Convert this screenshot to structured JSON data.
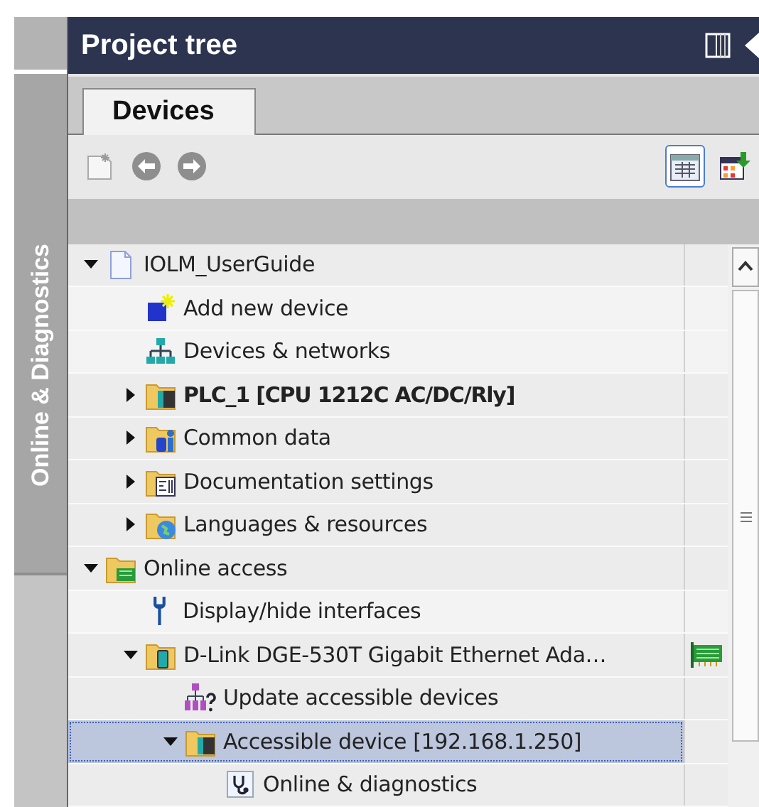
{
  "side_tab": {
    "label": "Online & Diagnostics"
  },
  "panel": {
    "title": "Project tree"
  },
  "tabs": [
    {
      "label": "Devices",
      "selected": true
    }
  ],
  "toolbar": {
    "view_selected": true
  },
  "tree": [
    {
      "label": "IOLM_UserGuide",
      "kind": "project",
      "expanded": true,
      "selected": false,
      "children": [
        {
          "label": "Add new device",
          "kind": "add",
          "selected": false
        },
        {
          "label": "Devices & networks",
          "kind": "network",
          "selected": false
        },
        {
          "label": "PLC_1 [CPU 1212C AC/DC/Rly]",
          "kind": "plc",
          "expanded": false,
          "emphasized": true,
          "selected": false
        },
        {
          "label": "Common data",
          "kind": "common",
          "expanded": false,
          "selected": false
        },
        {
          "label": "Documentation settings",
          "kind": "docs",
          "expanded": false,
          "selected": false
        },
        {
          "label": "Languages & resources",
          "kind": "languages",
          "expanded": false,
          "selected": false
        }
      ]
    },
    {
      "label": "Online access",
      "kind": "online",
      "expanded": true,
      "selected": false,
      "children": [
        {
          "label": "Display/hide interfaces",
          "kind": "wrench",
          "selected": false
        },
        {
          "label": "D-Link DGE-530T Gigabit Ethernet Ada…",
          "kind": "adapter",
          "expanded": true,
          "selected": false,
          "children": [
            {
              "label": "Update accessible devices",
              "kind": "update",
              "selected": false
            },
            {
              "label": "Accessible device [192.168.1.250]",
              "kind": "device",
              "expanded": true,
              "selected": true,
              "children": [
                {
                  "label": "Online & diagnostics",
                  "kind": "diagnostics",
                  "selected": false
                }
              ]
            }
          ]
        }
      ]
    }
  ]
}
